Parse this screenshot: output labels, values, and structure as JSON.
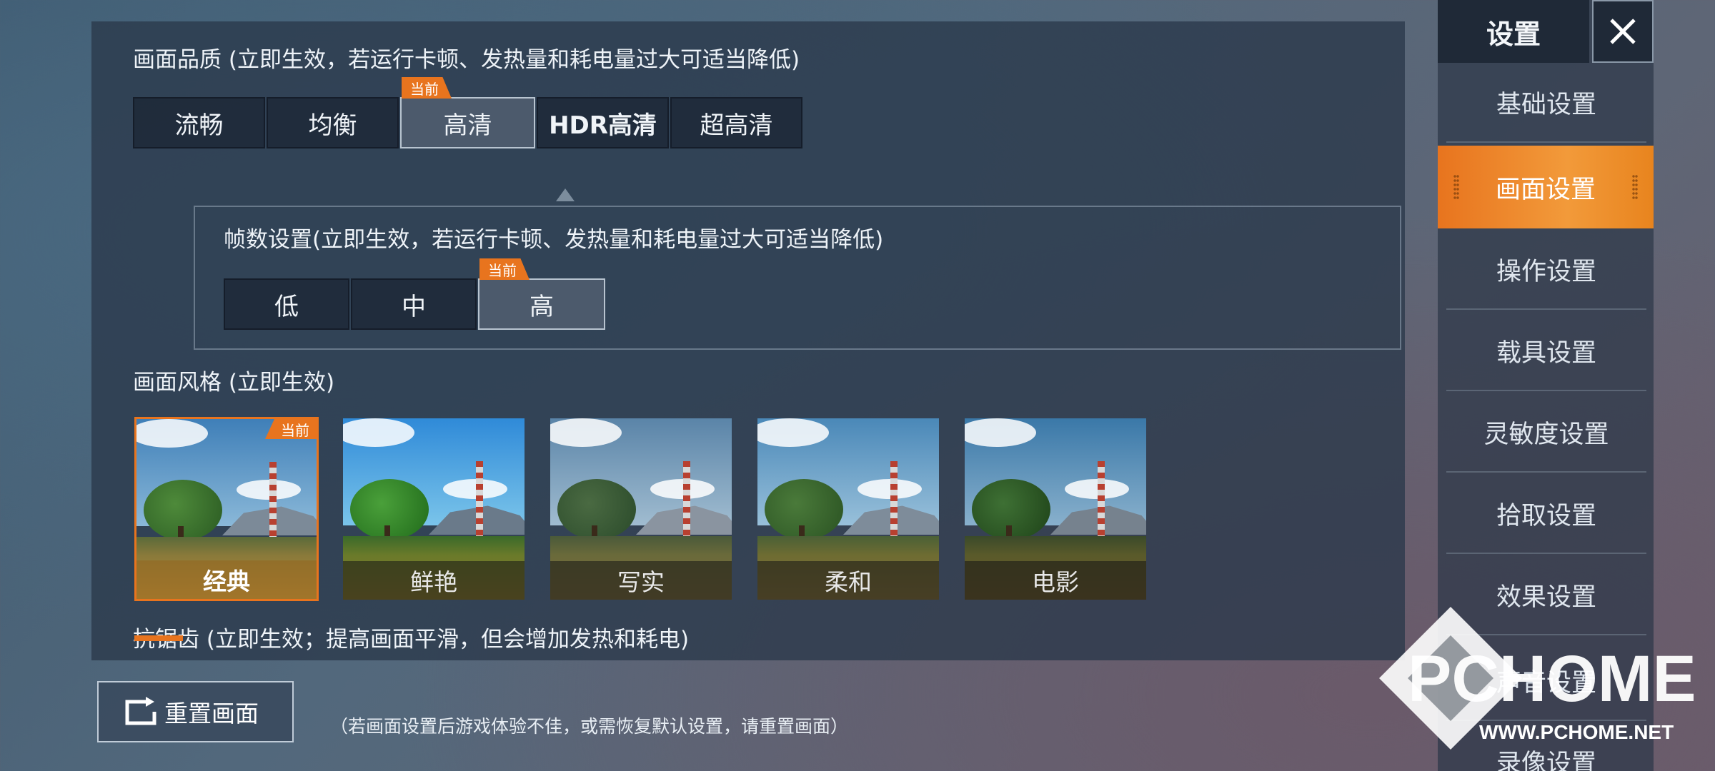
{
  "quality": {
    "title": "画面品质 (立即生效，若运行卡顿、发热量和耗电量过大可适当降低)",
    "current_badge": "当前",
    "options": [
      "流畅",
      "均衡",
      "高清",
      "HDR高清",
      "超高清"
    ],
    "selected": "高清"
  },
  "fps": {
    "title": "帧数设置(立即生效，若运行卡顿、发热量和耗电量过大可适当降低)",
    "current_badge": "当前",
    "options": [
      "低",
      "中",
      "高"
    ],
    "selected": "高"
  },
  "style": {
    "title": "画面风格 (立即生效)",
    "current_badge": "当前",
    "options": [
      "经典",
      "鲜艳",
      "写实",
      "柔和",
      "电影"
    ],
    "selected": "经典"
  },
  "antialias": {
    "title": "抗锯齿 (立即生效；提高画面平滑，但会增加发热和耗电)"
  },
  "footer": {
    "reset_label": "重置画面",
    "reset_note": "（若画面设置后游戏体验不佳，或需恢复默认设置，请重置画面）"
  },
  "sidebar": {
    "title": "设置",
    "items": [
      "基础设置",
      "画面设置",
      "操作设置",
      "载具设置",
      "灵敏度设置",
      "拾取设置",
      "效果设置",
      "声音设置",
      "录像设置"
    ],
    "selected": "画面设置"
  },
  "watermark": {
    "brand": "PCHOME",
    "url": "WWW.PCHOME.NET"
  },
  "colors": {
    "accent": "#e8741e",
    "panel": "#2a384a"
  },
  "icons": [
    "close-icon",
    "reset-icon"
  ]
}
